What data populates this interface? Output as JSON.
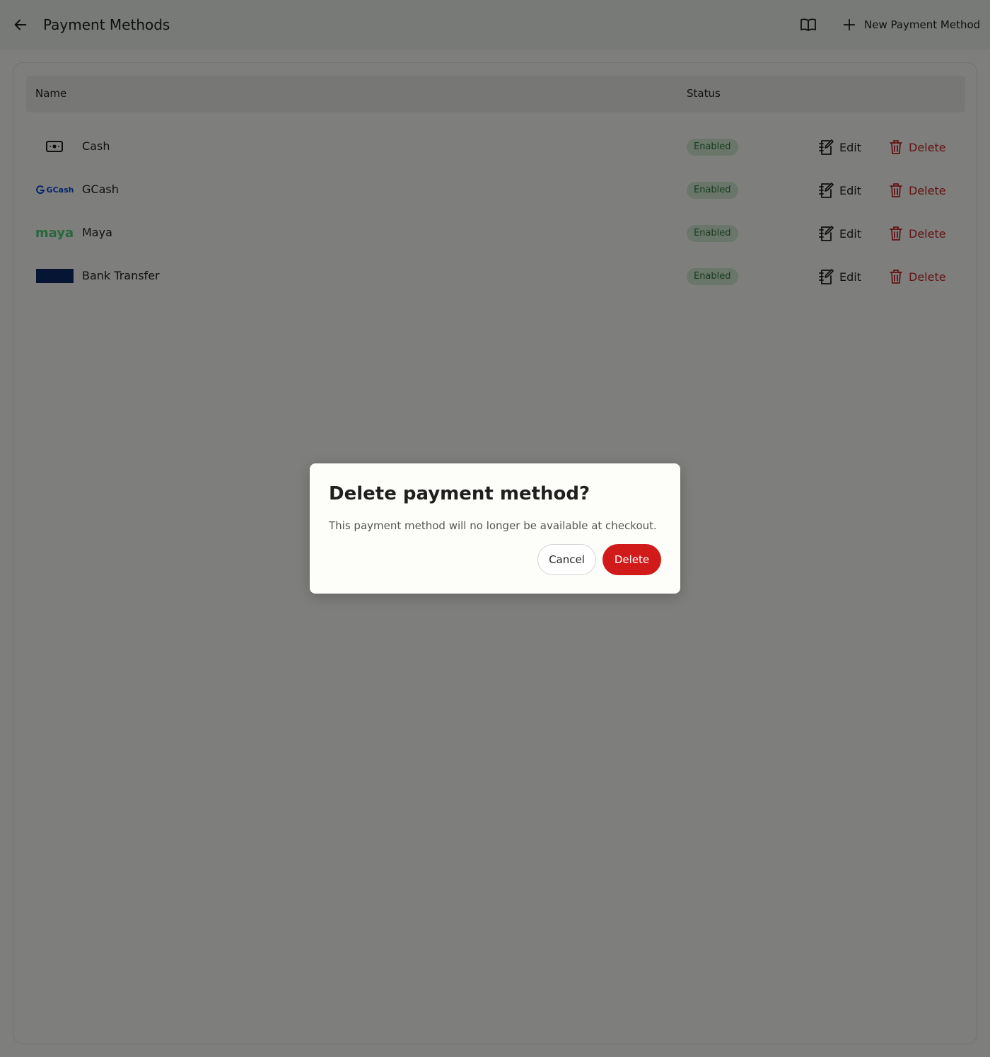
{
  "header": {
    "title": "Payment Methods",
    "back_icon": "arrow-left-icon",
    "docs_icon": "book-open-icon",
    "new_button_label": "New Payment Method",
    "new_icon": "plus-icon"
  },
  "table": {
    "columns": {
      "name": "Name",
      "status": "Status"
    },
    "rows": [
      {
        "name": "Cash",
        "logo": "cash-icon",
        "status": "Enabled",
        "edit_label": "Edit",
        "delete_label": "Delete"
      },
      {
        "name": "GCash",
        "logo": "gcash-logo",
        "logo_text": "GCash",
        "status": "Enabled",
        "edit_label": "Edit",
        "delete_label": "Delete"
      },
      {
        "name": "Maya",
        "logo": "maya-logo",
        "logo_text": "maya",
        "status": "Enabled",
        "edit_label": "Edit",
        "delete_label": "Delete"
      },
      {
        "name": "Bank Transfer",
        "logo": "bank-logo",
        "status": "Enabled",
        "edit_label": "Edit",
        "delete_label": "Delete"
      }
    ]
  },
  "dialog": {
    "title": "Delete payment method?",
    "message": "This payment method will no longer be available at checkout.",
    "cancel_label": "Cancel",
    "confirm_label": "Delete"
  },
  "colors": {
    "danger": "#d11b1b",
    "badge_bg": "#d7ecd7",
    "badge_text": "#2d7a3a",
    "gcash_blue": "#0b4fd6",
    "maya_green": "#4fd17b",
    "bank_navy": "#0f2a6b"
  }
}
